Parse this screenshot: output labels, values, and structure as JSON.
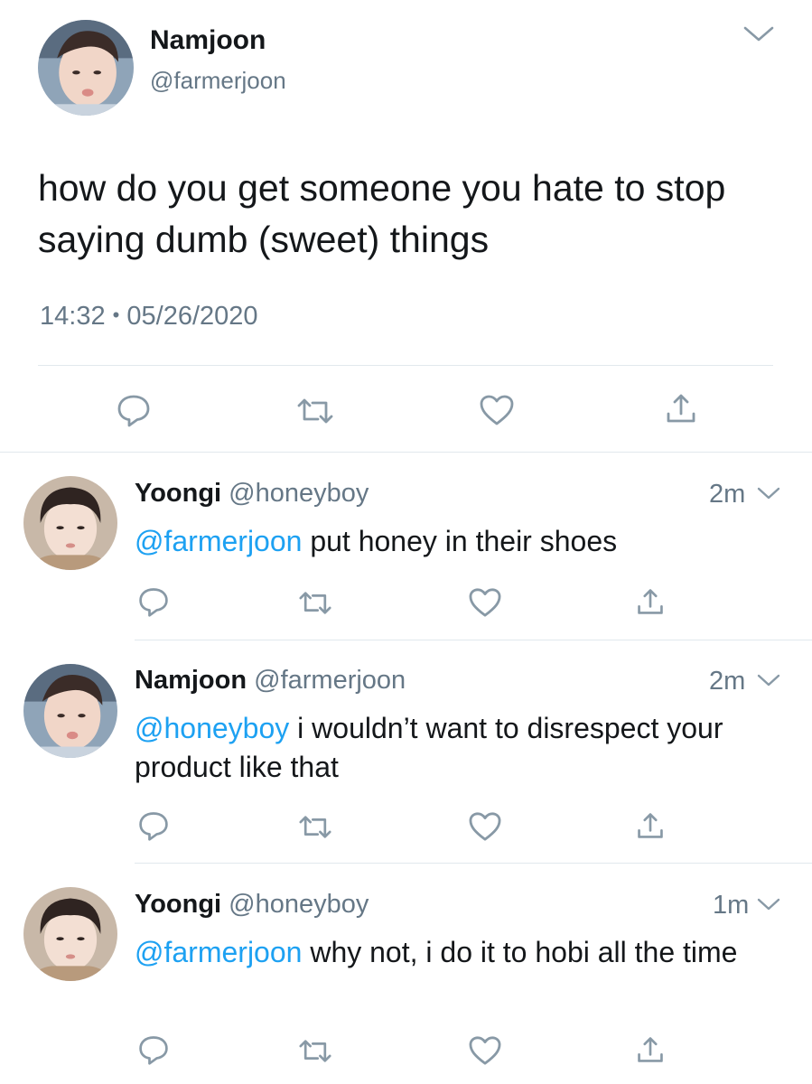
{
  "main_tweet": {
    "name": "Namjoon",
    "handle": "@farmerjoon",
    "text": "how do you get someone you hate to stop saying dumb (sweet) things",
    "time": "14:32",
    "separator": "•",
    "date": "05/26/2020",
    "actions": [
      "reply-icon",
      "retweet-icon",
      "like-icon",
      "share-icon"
    ]
  },
  "replies": [
    {
      "name": "Yoongi",
      "handle": "@honeyboy",
      "time": "2m",
      "mention": "@farmerjoon",
      "text": " put honey in their shoes"
    },
    {
      "name": "Namjoon",
      "handle": "@farmerjoon",
      "time": "2m",
      "mention": "@honeyboy",
      "text": " i wouldn’t want to disrespect your product like that"
    },
    {
      "name": "Yoongi",
      "handle": "@honeyboy",
      "time": "1m",
      "mention": "@farmerjoon",
      "text": " why not, i do it to hobi all the time"
    }
  ],
  "colors": {
    "text": "#14171a",
    "secondary": "#657786",
    "mention": "#1da1f2",
    "icon": "#8899a6",
    "divider": "#e1e8ed"
  }
}
